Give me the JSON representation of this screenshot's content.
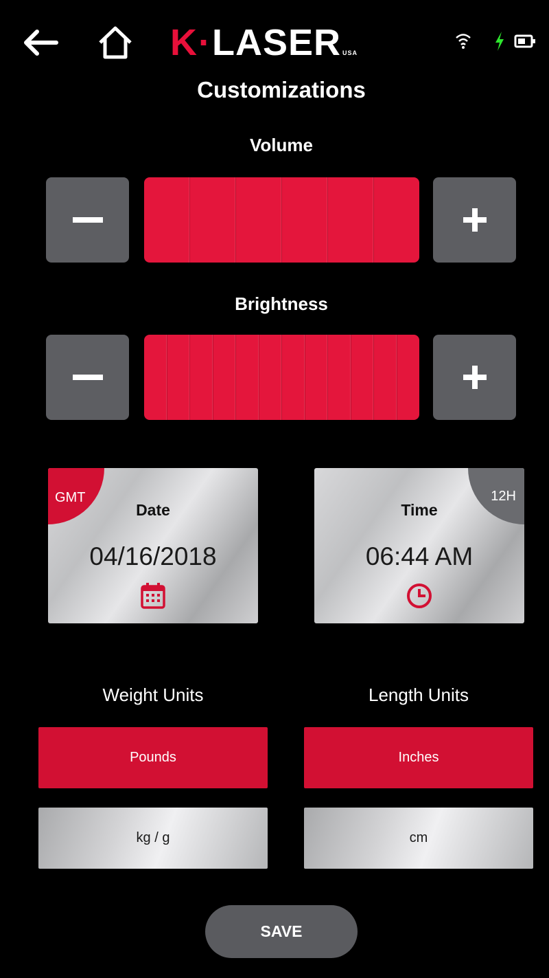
{
  "header": {
    "logo_k": "K",
    "logo_dot": "·",
    "logo_laser": "LASER",
    "logo_usa": "USA",
    "brand_color": "#e8103a",
    "icons": [
      "back-arrow-icon",
      "home-icon",
      "wifi-icon",
      "charging-bolt-icon",
      "battery-icon"
    ]
  },
  "page": {
    "title": "Customizations"
  },
  "volume": {
    "label": "Volume",
    "level_segments": 6,
    "max_segments": 6
  },
  "brightness": {
    "label": "Brightness",
    "level_segments": 12,
    "max_segments": 12
  },
  "date_card": {
    "badge": "GMT",
    "title": "Date",
    "value": "04/16/2018",
    "icon": "calendar-icon"
  },
  "time_card": {
    "badge": "12H",
    "title": "Time",
    "value": "06:44 AM",
    "icon": "clock-icon"
  },
  "weight_units": {
    "label": "Weight Units",
    "options": [
      "Pounds",
      "kg / g"
    ],
    "selected": "Pounds"
  },
  "length_units": {
    "label": "Length Units",
    "options": [
      "Inches",
      "cm"
    ],
    "selected": "Inches"
  },
  "actions": {
    "save_label": "SAVE"
  },
  "colors": {
    "accent": "#e4163c",
    "button_gray": "#5d5e62",
    "battery_bolt": "#2ee62e"
  }
}
